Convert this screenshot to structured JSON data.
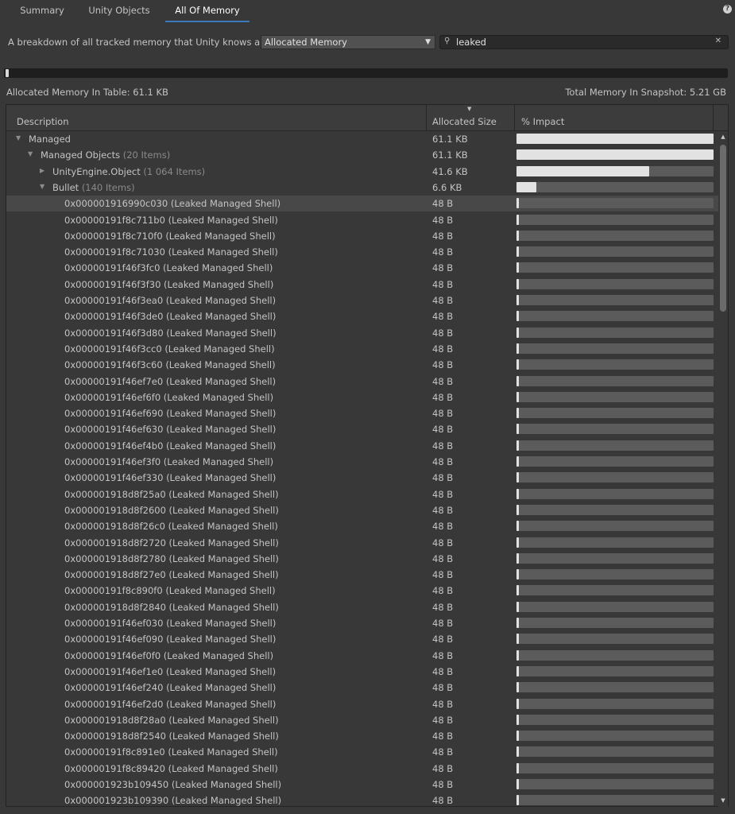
{
  "tabs": [
    {
      "label": "Summary"
    },
    {
      "label": "Unity Objects"
    },
    {
      "label": "All Of Memory"
    }
  ],
  "help_icon": "help-icon",
  "toolbar": {
    "description": "A breakdown of all tracked memory that Unity knows about.",
    "view_dropdown": "Allocated Memory",
    "search_value": "leaked"
  },
  "progress_fraction": 0.003,
  "stats": {
    "in_table": "Allocated Memory In Table: 61.1 KB",
    "total": "Total Memory In Snapshot: 5.21 GB"
  },
  "columns": {
    "description": "Description",
    "size": "Allocated Size",
    "impact": "% Impact"
  },
  "tree": [
    {
      "level": 0,
      "expanded": true,
      "name": "Managed",
      "count": "",
      "size": "61.1 KB",
      "impact": 1.0
    },
    {
      "level": 1,
      "expanded": true,
      "name": "Managed Objects",
      "count": "(20 Items)",
      "size": "61.1 KB",
      "impact": 1.0
    },
    {
      "level": 2,
      "expanded": false,
      "name": "UnityEngine.Object",
      "count": "(1 064 Items)",
      "size": "41.6 KB",
      "impact": 0.675
    },
    {
      "level": 2,
      "expanded": true,
      "name": "Bullet",
      "count": "(140 Items)",
      "size": "6.6 KB",
      "impact": 0.1
    }
  ],
  "leaf_size": "48 B",
  "leaf_impact": 0.012,
  "leaves": [
    "0x000001916990c030 (Leaked Managed Shell)",
    "0x00000191f8c711b0 (Leaked Managed Shell)",
    "0x00000191f8c710f0 (Leaked Managed Shell)",
    "0x00000191f8c71030 (Leaked Managed Shell)",
    "0x00000191f46f3fc0 (Leaked Managed Shell)",
    "0x00000191f46f3f30 (Leaked Managed Shell)",
    "0x00000191f46f3ea0 (Leaked Managed Shell)",
    "0x00000191f46f3de0 (Leaked Managed Shell)",
    "0x00000191f46f3d80 (Leaked Managed Shell)",
    "0x00000191f46f3cc0 (Leaked Managed Shell)",
    "0x00000191f46f3c60 (Leaked Managed Shell)",
    "0x00000191f46ef7e0 (Leaked Managed Shell)",
    "0x00000191f46ef6f0 (Leaked Managed Shell)",
    "0x00000191f46ef690 (Leaked Managed Shell)",
    "0x00000191f46ef630 (Leaked Managed Shell)",
    "0x00000191f46ef4b0 (Leaked Managed Shell)",
    "0x00000191f46ef3f0 (Leaked Managed Shell)",
    "0x00000191f46ef330 (Leaked Managed Shell)",
    "0x000001918d8f25a0 (Leaked Managed Shell)",
    "0x000001918d8f2600 (Leaked Managed Shell)",
    "0x000001918d8f26c0 (Leaked Managed Shell)",
    "0x000001918d8f2720 (Leaked Managed Shell)",
    "0x000001918d8f2780 (Leaked Managed Shell)",
    "0x000001918d8f27e0 (Leaked Managed Shell)",
    "0x00000191f8c890f0 (Leaked Managed Shell)",
    "0x000001918d8f2840 (Leaked Managed Shell)",
    "0x00000191f46ef030 (Leaked Managed Shell)",
    "0x00000191f46ef090 (Leaked Managed Shell)",
    "0x00000191f46ef0f0 (Leaked Managed Shell)",
    "0x00000191f46ef1e0 (Leaked Managed Shell)",
    "0x00000191f46ef240 (Leaked Managed Shell)",
    "0x00000191f46ef2d0 (Leaked Managed Shell)",
    "0x000001918d8f28a0 (Leaked Managed Shell)",
    "0x000001918d8f2540 (Leaked Managed Shell)",
    "0x00000191f8c891e0 (Leaked Managed Shell)",
    "0x00000191f8c89420 (Leaked Managed Shell)",
    "0x000001923b109450 (Leaked Managed Shell)",
    "0x000001923b109390 (Leaked Managed Shell)"
  ],
  "selected_leaf_index": 0
}
